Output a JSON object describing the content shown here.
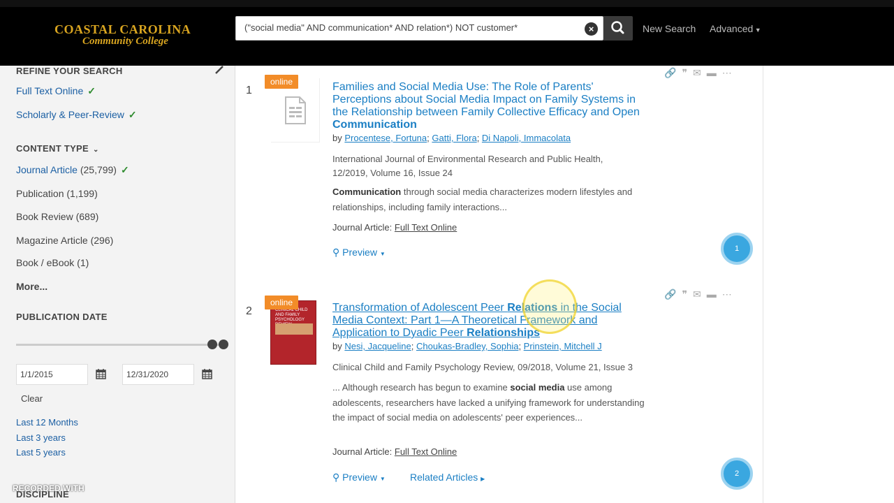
{
  "header": {
    "logo_line1": "COASTAL CAROLINA",
    "logo_line2": "Community College",
    "search_value": "(\"social media\" AND communication* AND relation*) NOT customer*",
    "new_search": "New Search",
    "advanced": "Advanced"
  },
  "sidebar": {
    "refine_heading": "REFINE YOUR SEARCH",
    "full_text": "Full Text Online",
    "scholarly": "Scholarly & Peer-Review",
    "content_type_heading": "CONTENT TYPE",
    "content_types": [
      {
        "label": "Journal Article",
        "count": "(25,799)"
      },
      {
        "label": "Publication",
        "count": "(1,199)"
      },
      {
        "label": "Book Review",
        "count": "(689)"
      },
      {
        "label": "Magazine Article",
        "count": "(296)"
      },
      {
        "label": "Book / eBook",
        "count": "(1)"
      }
    ],
    "more": "More...",
    "pubdate_heading": "PUBLICATION DATE",
    "date_from": "1/1/2015",
    "date_to": "12/31/2020",
    "clear": "Clear",
    "quick_ranges": [
      "Last 12 Months",
      "Last 3 years",
      "Last 5 years"
    ],
    "discipline_heading": "DISCIPLINE"
  },
  "results": [
    {
      "num": "1",
      "badge": "online",
      "title_plain": "Families and Social Media Use: The Role of Parents' Perceptions about Social Media Impact on Family Systems in the Relationship between Family Collective Efficacy and Open ",
      "title_bold": "Communication",
      "by": "by",
      "authors": [
        "Procentese, Fortuna",
        "Gatti, Flora",
        "Di Napoli, Immacolata"
      ],
      "source": "International Journal of Environmental Research and Public Health, 12/2019, Volume 16, Issue 24",
      "snippet_bold": "Communication",
      "snippet_rest": " through social media characterizes modern lifestyles and relationships, including family interactions...",
      "type_label": "Journal Article:",
      "fulltext": "Full Text Online",
      "preview": "Preview",
      "circle": "1"
    },
    {
      "num": "2",
      "badge": "online",
      "title_plain1": "Transformation of Adolescent Peer ",
      "title_bold1": "Relations",
      "title_plain2": " in the Social Media Context: Part 1—A Theoretical Framework and Application to Dyadic Peer ",
      "title_bold2": "Relationships",
      "by": "by",
      "authors": [
        "Nesi, Jacqueline",
        "Choukas-Bradley, Sophia",
        "Prinstein, Mitchell J"
      ],
      "source": "Clinical Child and Family Psychology Review, 09/2018, Volume 21, Issue 3",
      "snippet_a": "... Although research has begun to examine ",
      "snippet_bold": "social media",
      "snippet_b": " use among adolescents, researchers have lacked a unifying framework for understanding the impact of social media on adolescents' peer experiences...",
      "type_label": "Journal Article:",
      "fulltext": "Full Text Online",
      "preview": "Preview",
      "related": "Related Articles",
      "circle": "2",
      "cover_text": "CLINICAL CHILD AND FAMILY PSYCHOLOGY REVIEW"
    }
  ],
  "watermark": "RECORDED WITH"
}
